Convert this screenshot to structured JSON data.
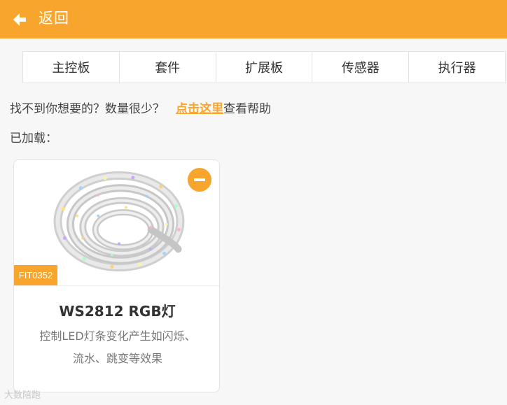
{
  "header": {
    "back_icon": "arrow-left-icon",
    "back_label": "返回",
    "color": "#f8a52e"
  },
  "tabs": [
    {
      "label": "主控板"
    },
    {
      "label": "套件"
    },
    {
      "label": "扩展板"
    },
    {
      "label": "传感器"
    },
    {
      "label": "执行器"
    }
  ],
  "hint": {
    "text": "找不到你想要的？数量很少？",
    "link": "点击这里",
    "suffix": "查看帮助"
  },
  "loaded_label": "已加载：",
  "card": {
    "code": "FIT0352",
    "title": "WS2812 RGB灯",
    "description_line1": "控制LED灯条变化产生如闪烁、",
    "description_line2": "流水、跳变等效果",
    "remove_icon": "minus-circle-icon"
  },
  "watermark": "大数陪跑"
}
